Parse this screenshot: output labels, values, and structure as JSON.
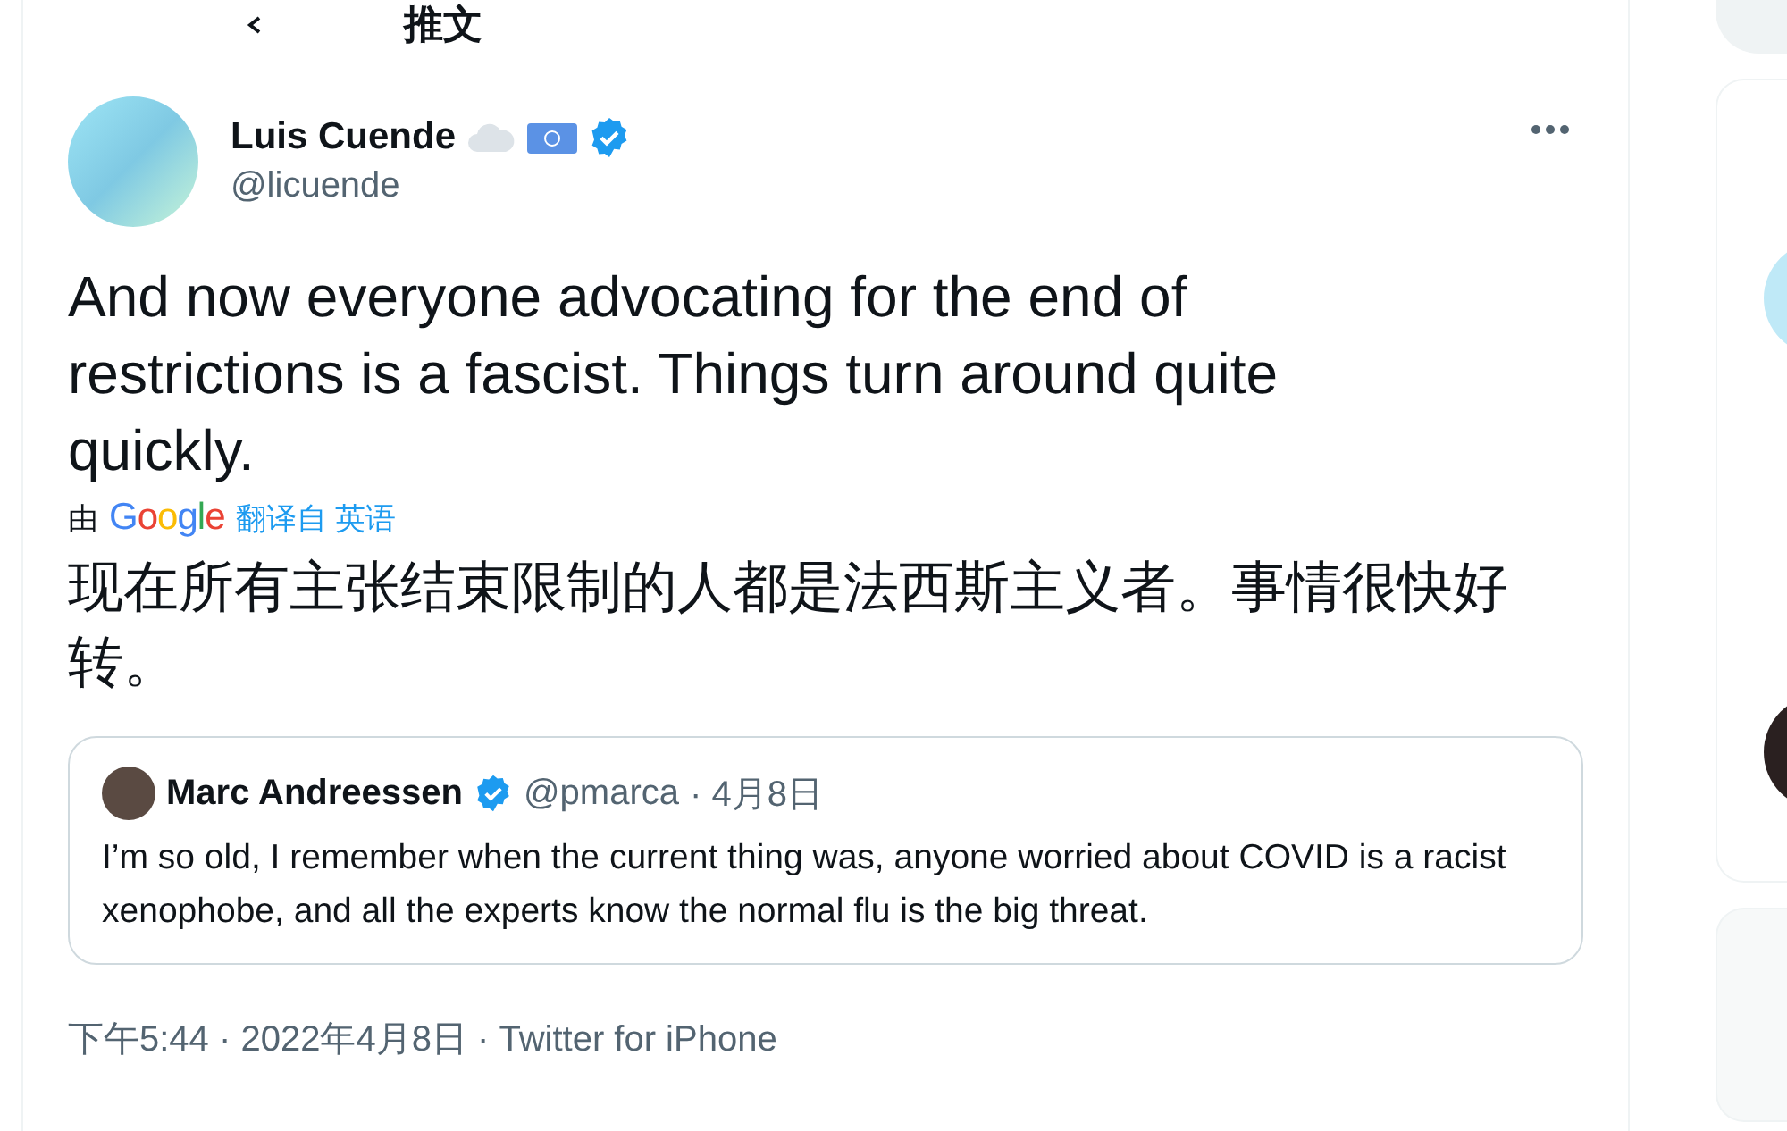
{
  "header": {
    "title": "推文"
  },
  "tweet": {
    "author": {
      "name": "Luis Cuende",
      "handle": "@licuende",
      "verified": true
    },
    "text": "And now everyone advocating for the end of restrictions is a fascist. Things turn around quite quickly.",
    "translation": {
      "prefix": "由",
      "provider": "Google",
      "link": "翻译自 英语",
      "text": "现在所有主张结束限制的人都是法西斯主义者。事情很快好转。"
    },
    "quote": {
      "name": "Marc Andreessen",
      "verified": true,
      "handle": "@pmarca",
      "date": "· 4月8日",
      "text": "I’m so old, I remember when the current thing was, anyone worried about COVID is a racist xenophobe, and all the experts know the normal flu is the big threat."
    },
    "meta": "下午5:44 · 2022年4月8日 · Twitter for iPhone"
  }
}
